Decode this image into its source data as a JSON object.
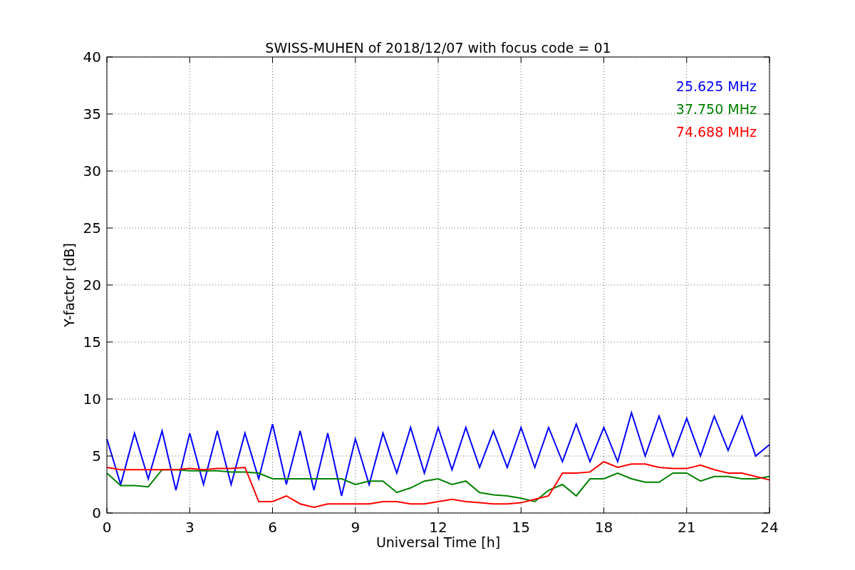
{
  "figure": {
    "chart_data": {
      "type": "line",
      "title": "SWISS-MUHEN of 2018/12/07 with focus code = 01",
      "xlabel": "Universal Time [h]",
      "ylabel": "Y-factor [dB]",
      "x": [
        0,
        0.5,
        1,
        1.5,
        2,
        2.5,
        3,
        3.5,
        4,
        4.5,
        5,
        5.5,
        6,
        6.5,
        7,
        7.5,
        8,
        8.5,
        9,
        9.5,
        10,
        10.5,
        11,
        11.5,
        12,
        12.5,
        13,
        13.5,
        14,
        14.5,
        15,
        15.5,
        16,
        16.5,
        17,
        17.5,
        18,
        18.5,
        19,
        19.5,
        20,
        20.5,
        21,
        21.5,
        22,
        22.5,
        23,
        23.5,
        24
      ],
      "series": [
        {
          "name": "25.625 MHz",
          "color": "#0000ff",
          "values": [
            6.5,
            2.5,
            7,
            3,
            7.2,
            2,
            7,
            2.5,
            7.2,
            2.5,
            7,
            3,
            7.8,
            2.5,
            7.2,
            2,
            7,
            1.5,
            6.5,
            2.5,
            7,
            3.5,
            7.5,
            3.5,
            7.5,
            3.8,
            7.5,
            4,
            7.2,
            4,
            7.5,
            4,
            7.5,
            4.5,
            7.8,
            4.5,
            7.5,
            4.5,
            8.8,
            5,
            8.5,
            5,
            8.3,
            5,
            8.5,
            5.5,
            8.5,
            5,
            6
          ]
        },
        {
          "name": "37.750 MHz",
          "color": "#008000",
          "values": [
            3.5,
            2.4,
            2.4,
            2.3,
            3.8,
            3.8,
            3.7,
            3.7,
            3.7,
            3.6,
            3.6,
            3.5,
            3,
            3,
            3,
            3,
            3,
            3,
            2.5,
            2.8,
            2.8,
            1.8,
            2.2,
            2.8,
            3,
            2.5,
            2.8,
            1.8,
            1.6,
            1.5,
            1.3,
            1,
            2,
            2.5,
            1.5,
            3,
            3,
            3.5,
            3,
            2.7,
            2.7,
            3.5,
            3.5,
            2.8,
            3.2,
            3.2,
            3,
            3,
            3.2
          ]
        },
        {
          "name": "74.688 MHz",
          "color": "#ff0000",
          "values": [
            4,
            3.8,
            3.8,
            3.8,
            3.8,
            3.8,
            3.9,
            3.8,
            3.9,
            3.9,
            4,
            1,
            1,
            1.5,
            0.8,
            0.5,
            0.8,
            0.8,
            0.8,
            0.8,
            1,
            1,
            0.8,
            0.8,
            1,
            1.2,
            1,
            0.9,
            0.8,
            0.8,
            0.9,
            1.2,
            1.5,
            3.5,
            3.5,
            3.6,
            4.5,
            4,
            4.3,
            4.3,
            4,
            3.9,
            3.9,
            4.2,
            3.8,
            3.5,
            3.5,
            3.2,
            2.9
          ]
        }
      ],
      "grid": true,
      "xlim": [
        0,
        24
      ],
      "ylim": [
        0,
        40
      ],
      "xticks": [
        0,
        3,
        6,
        9,
        12,
        15,
        18,
        21,
        24
      ],
      "yticks": [
        0,
        5,
        10,
        15,
        20,
        25,
        30,
        35,
        40
      ]
    }
  }
}
